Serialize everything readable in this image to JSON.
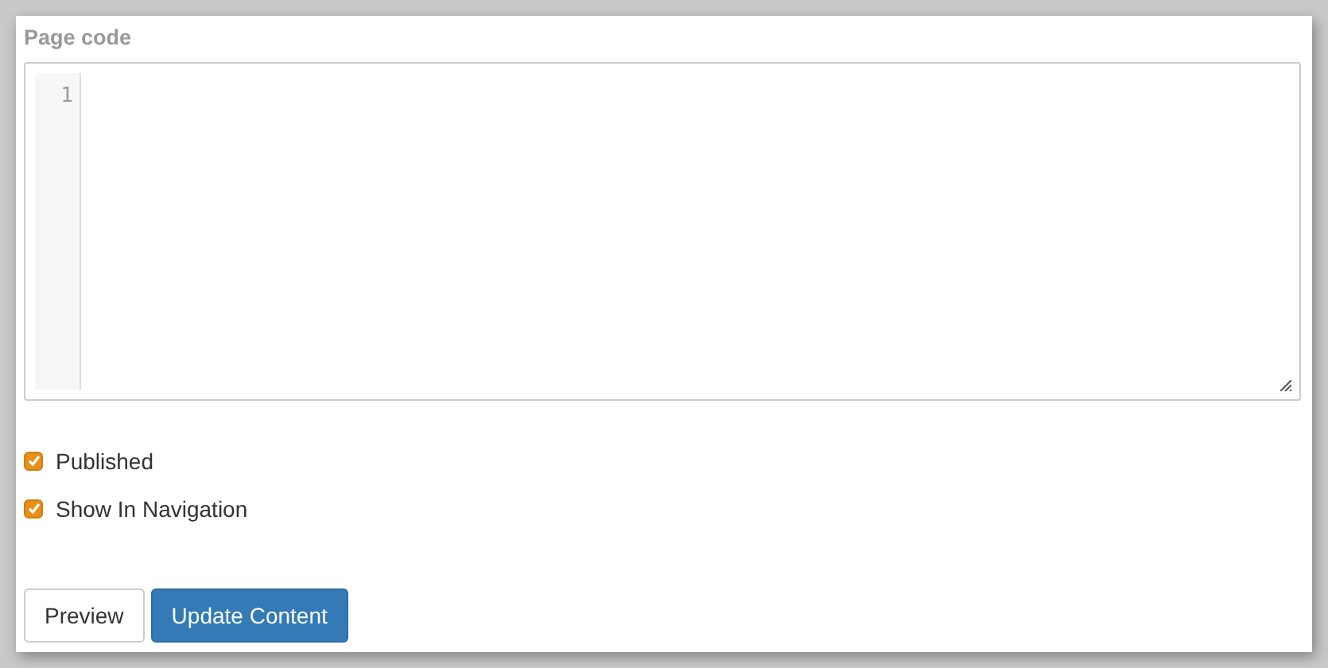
{
  "editor": {
    "label": "Page code",
    "line_numbers": [
      "1"
    ]
  },
  "options": [
    {
      "label": "Published",
      "checked": true
    },
    {
      "label": "Show In Navigation",
      "checked": true
    }
  ],
  "buttons": [
    {
      "label": "Preview",
      "kind": "default"
    },
    {
      "label": "Update Content",
      "kind": "primary"
    }
  ]
}
